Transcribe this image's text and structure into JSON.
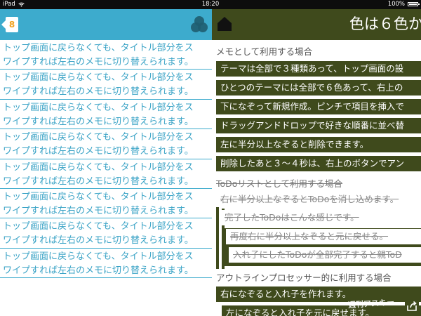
{
  "status_bar": {
    "device": "iPad",
    "time": "18:20",
    "battery": "100%"
  },
  "left_panel": {
    "badge_count": "8",
    "icons": {
      "badge": "tab-badge-icon",
      "theme": "color-circles-icon"
    },
    "memos": [
      {
        "line1": "トップ画面に戻らなくても、タイトル部分をス",
        "line2": "ワイプすれば左右のメモに切り替えられます。"
      },
      {
        "line1": "トップ画面に戻らなくても、タイトル部分をス",
        "line2": "ワイプすれば左右のメモに切り替えられます。"
      },
      {
        "line1": "トップ画面に戻らなくても、タイトル部分をス",
        "line2": "ワイプすれば左右のメモに切り替えられます。"
      },
      {
        "line1": "トップ画面に戻らなくても、タイトル部分をス",
        "line2": "ワイプすれば左右のメモに切り替えられます。"
      },
      {
        "line1": "トップ画面に戻らなくても、タイトル部分をス",
        "line2": "ワイプすれば左右のメモに切り替えられます。"
      },
      {
        "line1": "トップ画面に戻らなくても、タイトル部分をス",
        "line2": "ワイプすれば左右のメモに切り替えられます。"
      },
      {
        "line1": "トップ画面に戻らなくても、タイトル部分をス",
        "line2": "ワイプすれば左右のメモに切り替えられます。"
      },
      {
        "line1": "トップ画面に戻らなくても、タイトル部分をス",
        "line2": "ワイプすれば左右のメモに切り替えられます。"
      }
    ]
  },
  "right_panel": {
    "title": "色は６色か",
    "icons": {
      "home": "home-icon",
      "share": "share-icon"
    },
    "section1_title": "メモとして利用する場合",
    "section1_items": [
      "テーマは全部で３種類あって、トップ画面の設",
      "ひとつのテーマには全部で６色あって、右上の",
      "下になぞって新規作成。ピンチで項目を挿入で",
      "ドラッグアンドドロップで好きな順番に並べ替",
      "左に半分以上なぞると削除できます。",
      "削除したあと３〜４秒は、右上のボタンでアン"
    ],
    "section2_title": "ToDoリストとして利用する場合",
    "section2_items": [
      "右に半分以上なぞるとToDoを消し込めます。",
      "完了したToDoはこんな感じです。",
      "再度右に半分以上なぞると元に戻せる。",
      "入れ子にしたToDoが全部完了すると親ToD"
    ],
    "section3_title": "アウトラインプロセッサー的に利用する場合",
    "section3_items": [
      "右になぞると入れ子を作れます。",
      "左になぞると入れ子を元に戻せます。"
    ],
    "watermark": "週刊アスキー"
  },
  "colors": {
    "left_accent": "#3dabcd",
    "left_text": "#3aa3c6",
    "right_accent": "#3f4a1c",
    "badge_number": "#f0a11e"
  }
}
